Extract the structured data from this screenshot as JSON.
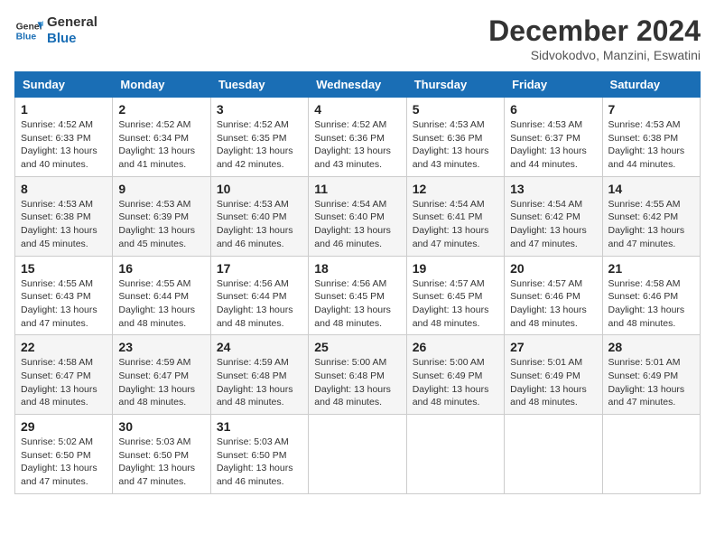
{
  "header": {
    "logo_line1": "General",
    "logo_line2": "Blue",
    "month": "December 2024",
    "location": "Sidvokodvo, Manzini, Eswatini"
  },
  "weekdays": [
    "Sunday",
    "Monday",
    "Tuesday",
    "Wednesday",
    "Thursday",
    "Friday",
    "Saturday"
  ],
  "weeks": [
    [
      {
        "day": "1",
        "info": "Sunrise: 4:52 AM\nSunset: 6:33 PM\nDaylight: 13 hours and 40 minutes."
      },
      {
        "day": "2",
        "info": "Sunrise: 4:52 AM\nSunset: 6:34 PM\nDaylight: 13 hours and 41 minutes."
      },
      {
        "day": "3",
        "info": "Sunrise: 4:52 AM\nSunset: 6:35 PM\nDaylight: 13 hours and 42 minutes."
      },
      {
        "day": "4",
        "info": "Sunrise: 4:52 AM\nSunset: 6:36 PM\nDaylight: 13 hours and 43 minutes."
      },
      {
        "day": "5",
        "info": "Sunrise: 4:53 AM\nSunset: 6:36 PM\nDaylight: 13 hours and 43 minutes."
      },
      {
        "day": "6",
        "info": "Sunrise: 4:53 AM\nSunset: 6:37 PM\nDaylight: 13 hours and 44 minutes."
      },
      {
        "day": "7",
        "info": "Sunrise: 4:53 AM\nSunset: 6:38 PM\nDaylight: 13 hours and 44 minutes."
      }
    ],
    [
      {
        "day": "8",
        "info": "Sunrise: 4:53 AM\nSunset: 6:38 PM\nDaylight: 13 hours and 45 minutes."
      },
      {
        "day": "9",
        "info": "Sunrise: 4:53 AM\nSunset: 6:39 PM\nDaylight: 13 hours and 45 minutes."
      },
      {
        "day": "10",
        "info": "Sunrise: 4:53 AM\nSunset: 6:40 PM\nDaylight: 13 hours and 46 minutes."
      },
      {
        "day": "11",
        "info": "Sunrise: 4:54 AM\nSunset: 6:40 PM\nDaylight: 13 hours and 46 minutes."
      },
      {
        "day": "12",
        "info": "Sunrise: 4:54 AM\nSunset: 6:41 PM\nDaylight: 13 hours and 47 minutes."
      },
      {
        "day": "13",
        "info": "Sunrise: 4:54 AM\nSunset: 6:42 PM\nDaylight: 13 hours and 47 minutes."
      },
      {
        "day": "14",
        "info": "Sunrise: 4:55 AM\nSunset: 6:42 PM\nDaylight: 13 hours and 47 minutes."
      }
    ],
    [
      {
        "day": "15",
        "info": "Sunrise: 4:55 AM\nSunset: 6:43 PM\nDaylight: 13 hours and 47 minutes."
      },
      {
        "day": "16",
        "info": "Sunrise: 4:55 AM\nSunset: 6:44 PM\nDaylight: 13 hours and 48 minutes."
      },
      {
        "day": "17",
        "info": "Sunrise: 4:56 AM\nSunset: 6:44 PM\nDaylight: 13 hours and 48 minutes."
      },
      {
        "day": "18",
        "info": "Sunrise: 4:56 AM\nSunset: 6:45 PM\nDaylight: 13 hours and 48 minutes."
      },
      {
        "day": "19",
        "info": "Sunrise: 4:57 AM\nSunset: 6:45 PM\nDaylight: 13 hours and 48 minutes."
      },
      {
        "day": "20",
        "info": "Sunrise: 4:57 AM\nSunset: 6:46 PM\nDaylight: 13 hours and 48 minutes."
      },
      {
        "day": "21",
        "info": "Sunrise: 4:58 AM\nSunset: 6:46 PM\nDaylight: 13 hours and 48 minutes."
      }
    ],
    [
      {
        "day": "22",
        "info": "Sunrise: 4:58 AM\nSunset: 6:47 PM\nDaylight: 13 hours and 48 minutes."
      },
      {
        "day": "23",
        "info": "Sunrise: 4:59 AM\nSunset: 6:47 PM\nDaylight: 13 hours and 48 minutes."
      },
      {
        "day": "24",
        "info": "Sunrise: 4:59 AM\nSunset: 6:48 PM\nDaylight: 13 hours and 48 minutes."
      },
      {
        "day": "25",
        "info": "Sunrise: 5:00 AM\nSunset: 6:48 PM\nDaylight: 13 hours and 48 minutes."
      },
      {
        "day": "26",
        "info": "Sunrise: 5:00 AM\nSunset: 6:49 PM\nDaylight: 13 hours and 48 minutes."
      },
      {
        "day": "27",
        "info": "Sunrise: 5:01 AM\nSunset: 6:49 PM\nDaylight: 13 hours and 48 minutes."
      },
      {
        "day": "28",
        "info": "Sunrise: 5:01 AM\nSunset: 6:49 PM\nDaylight: 13 hours and 47 minutes."
      }
    ],
    [
      {
        "day": "29",
        "info": "Sunrise: 5:02 AM\nSunset: 6:50 PM\nDaylight: 13 hours and 47 minutes."
      },
      {
        "day": "30",
        "info": "Sunrise: 5:03 AM\nSunset: 6:50 PM\nDaylight: 13 hours and 47 minutes."
      },
      {
        "day": "31",
        "info": "Sunrise: 5:03 AM\nSunset: 6:50 PM\nDaylight: 13 hours and 46 minutes."
      },
      null,
      null,
      null,
      null
    ]
  ]
}
